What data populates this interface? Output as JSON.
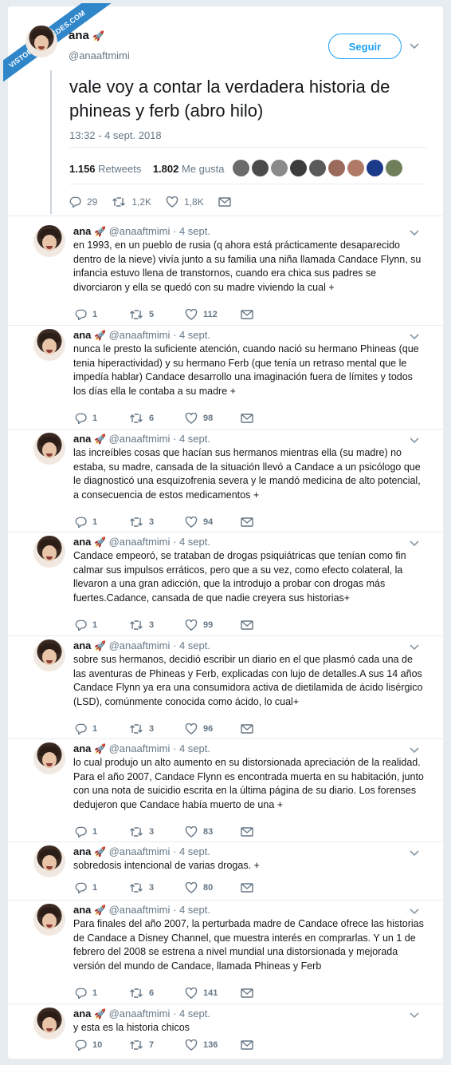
{
  "watermark": "VISTOENLASREDES.COM",
  "main": {
    "name": "ana",
    "name_emoji": "🚀",
    "handle": "@anaaftmimi",
    "follow_label": "Seguir",
    "text": "vale voy a contar la verdadera historia de phineas y ferb (abro hilo)",
    "timestamp": "13:32 - 4 sept. 2018",
    "retweets_count": "1.156",
    "retweets_label": "Retweets",
    "likes_count": "1.802",
    "likes_label": "Me gusta",
    "actions": {
      "replies": "29",
      "retweets": "1,2K",
      "likes": "1,8K"
    }
  },
  "likers_colors": [
    "#6b6b6b",
    "#4b4b4b",
    "#8a8a8a",
    "#3c3c3c",
    "#5a5a5a",
    "#9a6a5a",
    "#b07a66",
    "#1c3a8a",
    "#6f7f5a"
  ],
  "replies": [
    {
      "name": "ana",
      "handle": "@anaaftmimi",
      "date": "4 sept.",
      "text": "en 1993, en un pueblo de rusia (q ahora está prácticamente desaparecido dentro de la nieve) vivía junto a su familia una niña llamada Candace Flynn, su infancia estuvo llena de transtornos, cuando era chica sus padres se divorciaron y ella se quedó con su madre viviendo la cual +",
      "replies": "1",
      "retweets": "5",
      "likes": "112"
    },
    {
      "name": "ana",
      "handle": "@anaaftmimi",
      "date": "4 sept.",
      "text": "nunca le presto la suficiente atención, cuando nació su hermano Phineas (que tenia hiperactividad) y su hermano Ferb (que tenía un retraso mental que le impedía hablar) Candace desarrollo una imaginación fuera de límites y todos los días ella le contaba a su madre +",
      "replies": "1",
      "retweets": "6",
      "likes": "98"
    },
    {
      "name": "ana",
      "handle": "@anaaftmimi",
      "date": "4 sept.",
      "text": "las increíbles cosas que hacían sus hermanos mientras ella (su madre) no estaba, su madre, cansada de la situación llevó a Candace a un psicólogo que le diagnosticó una esquizofrenia severa y le mandó medicina de alto potencial, a consecuencia de estos medicamentos +",
      "replies": "1",
      "retweets": "3",
      "likes": "94"
    },
    {
      "name": "ana",
      "handle": "@anaaftmimi",
      "date": "4 sept.",
      "text": "Candace empeoró, se trataban de drogas psiquiátricas que tenían como fin calmar sus impulsos erráticos, pero que a su vez, como efecto colateral, la llevaron a una gran adicción, que la introdujo a probar con drogas más fuertes.Cadance, cansada de que nadie creyera sus historias+",
      "replies": "1",
      "retweets": "3",
      "likes": "99"
    },
    {
      "name": "ana",
      "handle": "@anaaftmimi",
      "date": "4 sept.",
      "text": "sobre sus hermanos, decidió escribir un diario en el que plasmó cada una de las aventuras de Phineas y Ferb, explicadas con lujo de detalles.A sus 14 años Candace Flynn ya era una consumidora activa de dietilamida de ácido lisérgico (LSD), comúnmente conocida como ácido, lo cual+",
      "replies": "1",
      "retweets": "3",
      "likes": "96"
    },
    {
      "name": "ana",
      "handle": "@anaaftmimi",
      "date": "4 sept.",
      "text": "lo cual produjo un alto aumento en su distorsionada apreciación de la realidad. Para el año 2007, Candace Flynn es encontrada muerta en su habitación, junto con una nota de suicidio escrita en la última página de su diario. Los forenses dedujeron que Candace había muerto de una +",
      "replies": "1",
      "retweets": "3",
      "likes": "83"
    },
    {
      "name": "ana",
      "handle": "@anaaftmimi",
      "date": "4 sept.",
      "text": "sobredosis intencional de varias drogas. +",
      "replies": "1",
      "retweets": "3",
      "likes": "80"
    },
    {
      "name": "ana",
      "handle": "@anaaftmimi",
      "date": "4 sept.",
      "text": "Para finales del año 2007, la perturbada madre de Candace ofrece las historias de Candace a Disney Channel, que muestra interés en comprarlas. Y un 1 de febrero del 2008 se estrena a nivel mundial una distorsionada y mejorada versión del mundo de Candace, llamada Phineas y Ferb",
      "replies": "1",
      "retweets": "6",
      "likes": "141"
    },
    {
      "name": "ana",
      "handle": "@anaaftmimi",
      "date": "4 sept.",
      "text": "y esta es la historia chicos",
      "replies": "10",
      "retweets": "7",
      "likes": "136"
    }
  ]
}
